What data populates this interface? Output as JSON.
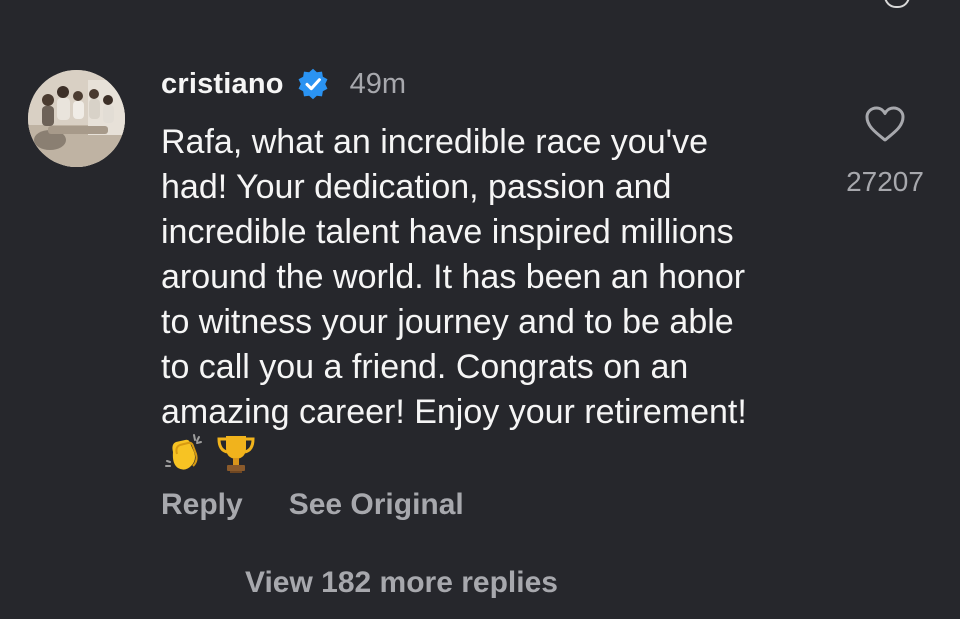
{
  "comment": {
    "username": "cristiano",
    "verified_icon": "verified-badge-icon",
    "time_ago": "49m",
    "text": "Rafa, what an incredible race you've\nhad! Your dedication, passion and\nincredible talent have inspired millions\naround the world. It has been an honor\nto witness your journey and to be able\nto call you a friend. Congrats on an\namazing career! Enjoy your retirement!",
    "emojis": [
      "👏",
      "🏆"
    ],
    "like_icon": "heart-outline-icon",
    "like_count": "27207"
  },
  "actions": {
    "reply_label": "Reply",
    "see_original_label": "See Original"
  },
  "view_more_label": "View 182 more replies",
  "colors": {
    "background": "#26272c",
    "text_primary": "#f5f5f5",
    "text_secondary": "#a7a8ad",
    "verified_blue": "#2a93f2"
  }
}
